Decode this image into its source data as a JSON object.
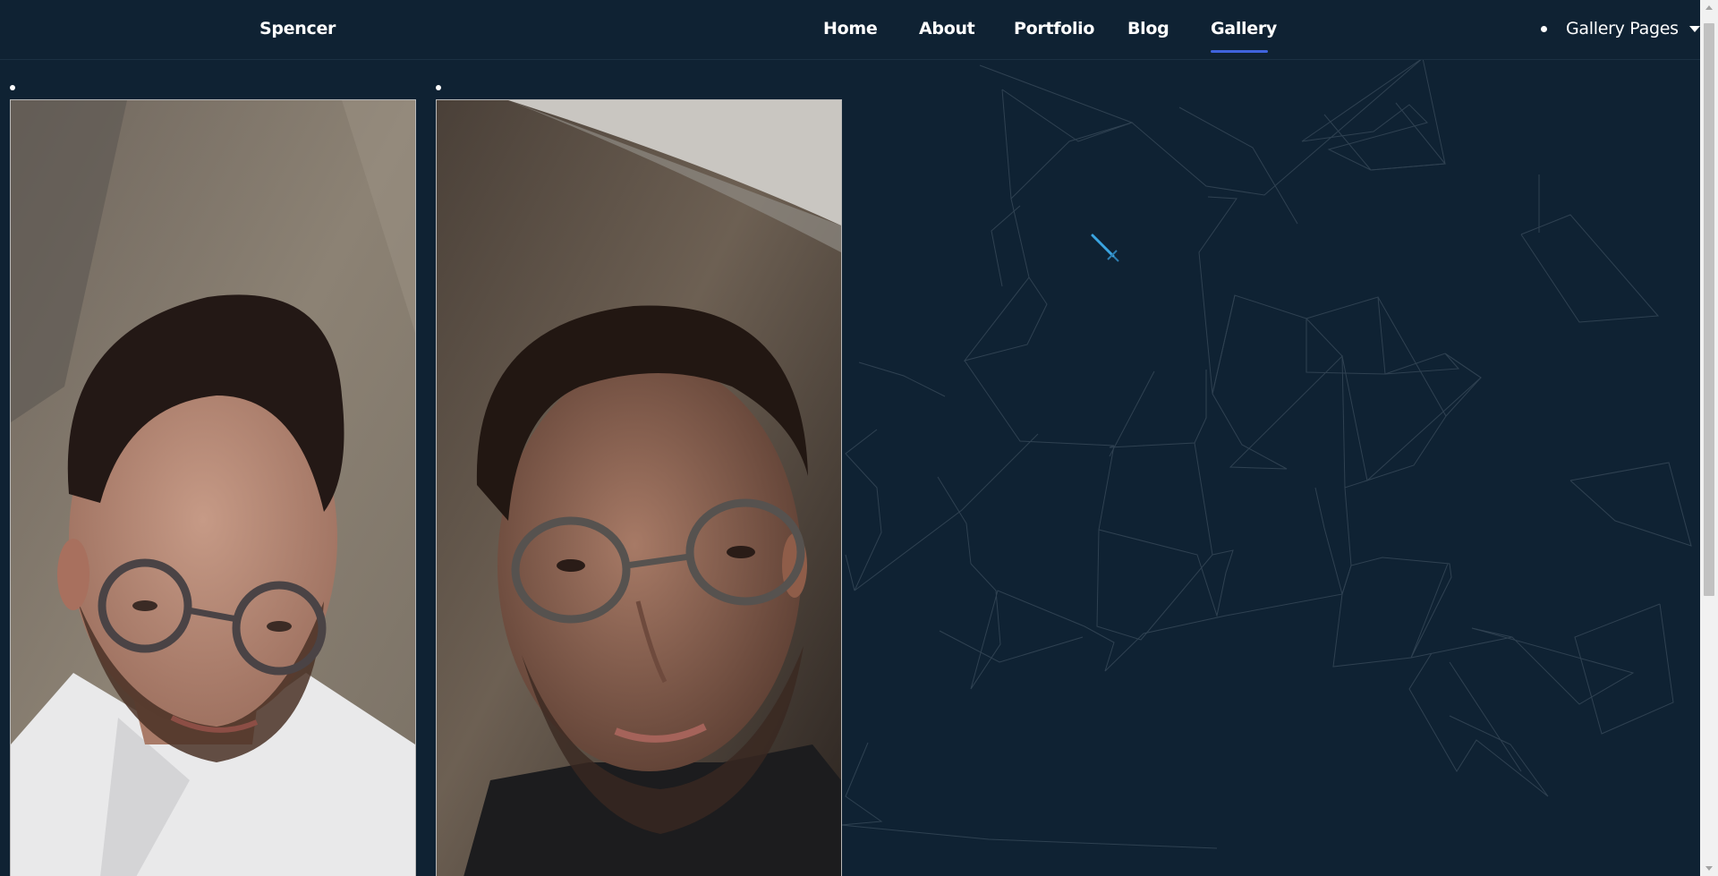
{
  "brand": {
    "name": "Spencer"
  },
  "nav": {
    "items": [
      {
        "label": "Home"
      },
      {
        "label": "About"
      },
      {
        "label": "Portfolio"
      },
      {
        "label": "Blog"
      },
      {
        "label": "Gallery"
      }
    ],
    "active": "Gallery",
    "dropdown_label": "Gallery Pages"
  },
  "gallery": {
    "photos": [
      {
        "icon": "portrait-photo"
      },
      {
        "icon": "portrait-photo"
      }
    ]
  },
  "colors": {
    "background": "#0f2233",
    "accent": "#3f63dd",
    "text": "#ffffff",
    "network_lines": "#3a4c5c"
  }
}
